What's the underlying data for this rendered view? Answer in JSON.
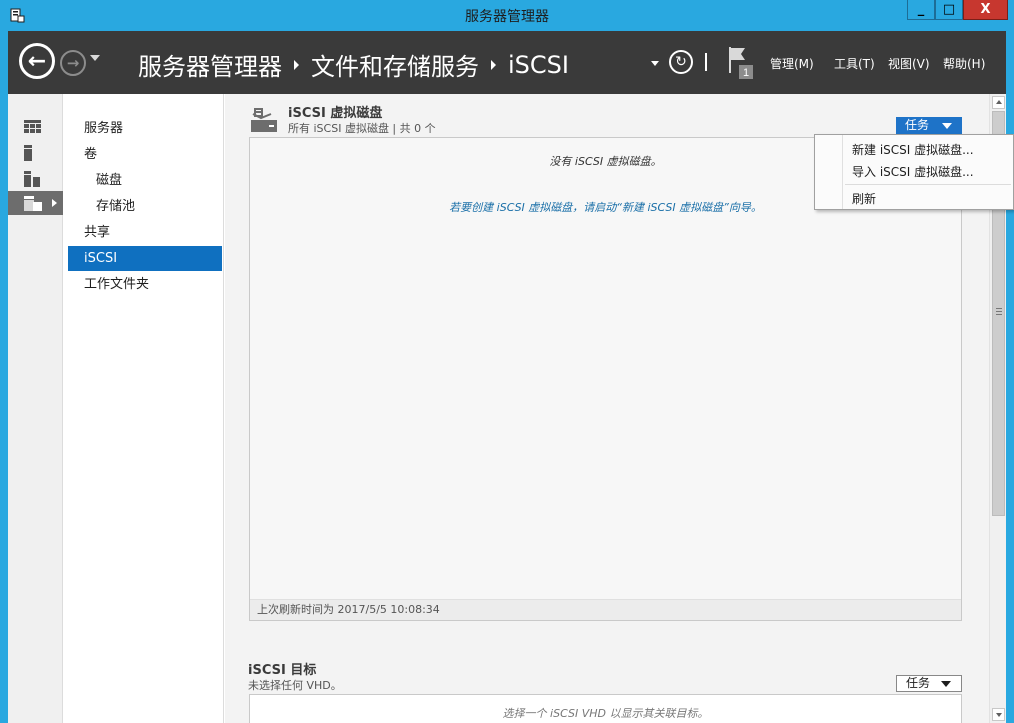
{
  "window": {
    "title": "服务器管理器",
    "minimize_label": "_",
    "maximize_label": "□",
    "close_label": "X"
  },
  "header": {
    "breadcrumb": [
      "服务器管理器",
      "文件和存储服务",
      "iSCSI"
    ],
    "notification_count": "1",
    "menus": [
      "管理(M)",
      "工具(T)",
      "视图(V)",
      "帮助(H)"
    ]
  },
  "nav": {
    "items": [
      {
        "label": "服务器",
        "sub": false,
        "selected": false
      },
      {
        "label": "卷",
        "sub": false,
        "selected": false
      },
      {
        "label": "磁盘",
        "sub": true,
        "selected": false
      },
      {
        "label": "存储池",
        "sub": true,
        "selected": false
      },
      {
        "label": "共享",
        "sub": false,
        "selected": false
      },
      {
        "label": "iSCSI",
        "sub": false,
        "selected": true
      },
      {
        "label": "工作文件夹",
        "sub": false,
        "selected": false
      }
    ]
  },
  "disks_section": {
    "title": "iSCSI 虚拟磁盘",
    "subtitle": "所有 iSCSI 虚拟磁盘 | 共 0 个",
    "tasks_label": "任务",
    "empty_message": "没有 iSCSI 虚拟磁盘。",
    "hint": "若要创建 iSCSI 虚拟磁盘，请启动“新建 iSCSI 虚拟磁盘”向导。",
    "last_refresh": "上次刷新时间为 2017/5/5 10:08:34"
  },
  "targets_section": {
    "title": "iSCSI 目标",
    "subtitle": "未选择任何 VHD。",
    "tasks_label": "任务",
    "message": "选择一个 iSCSI VHD 以显示其关联目标。"
  },
  "context_menu": {
    "items": [
      "新建 iSCSI 虚拟磁盘...",
      "导入 iSCSI 虚拟磁盘...",
      "刷新"
    ]
  },
  "colors": {
    "frame": "#29a8e0",
    "header": "#3a3a3a",
    "selection": "#0f70c0",
    "tasks_button": "#1e73c8",
    "close_button": "#c7372f"
  }
}
